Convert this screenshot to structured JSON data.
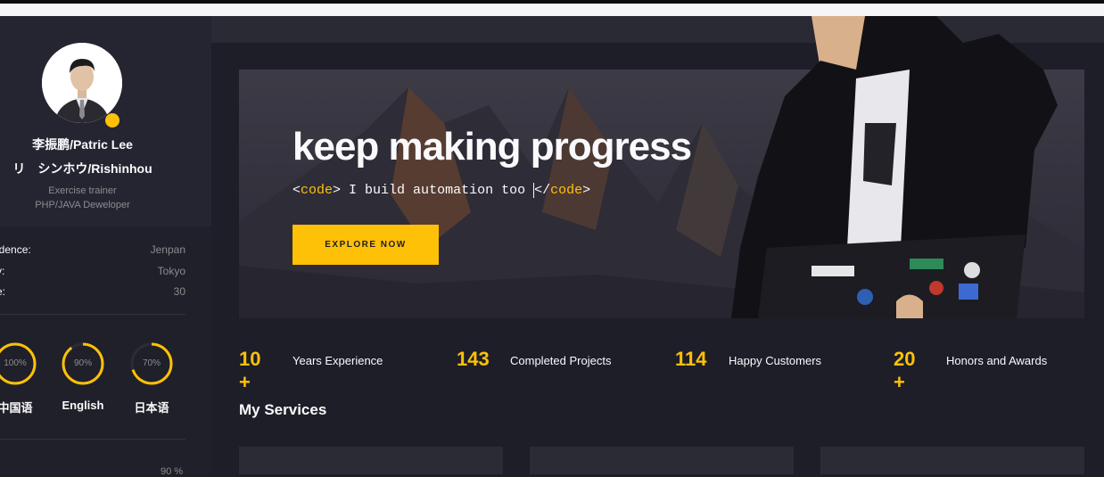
{
  "profile": {
    "name_line1": "李振鹏/Patric Lee",
    "name_line2": "リ　シンホウ/Rishinhou",
    "role_line1": "Exercise trainer",
    "role_line2": "PHP/JAVA Deweloper",
    "status_color": "#ffc107"
  },
  "info": [
    {
      "key": "idence:",
      "value": "Jenpan"
    },
    {
      "key": "y:",
      "value": "Tokyo"
    },
    {
      "key": "e:",
      "value": "30"
    }
  ],
  "languages": [
    {
      "label": "中国语",
      "percent_text": "100%",
      "percent": 100
    },
    {
      "label": "English",
      "percent_text": "90%",
      "percent": 90
    },
    {
      "label": "日本语",
      "percent_text": "70%",
      "percent": 70
    }
  ],
  "sidebar_bottom_percent": "90 %",
  "hero": {
    "title": "keep making progress",
    "code_open_lt": "<",
    "code_open_kw": "code",
    "code_open_gt": ">",
    "code_text": " I build automation too ",
    "code_close_lt": "</",
    "code_close_kw": "code",
    "code_close_gt": ">",
    "cta_label": "EXPLORE NOW"
  },
  "stats": [
    {
      "number": "10 +",
      "label": "Years Experience"
    },
    {
      "number": "143",
      "label": "Completed Projects"
    },
    {
      "number": "114",
      "label": "Happy Customers"
    },
    {
      "number": "20 +",
      "label": "Honors and Awards"
    }
  ],
  "services": {
    "title": "My Services"
  },
  "colors": {
    "accent": "#ffc107",
    "background": "#1e1e28",
    "sidebar": "#20202a"
  }
}
